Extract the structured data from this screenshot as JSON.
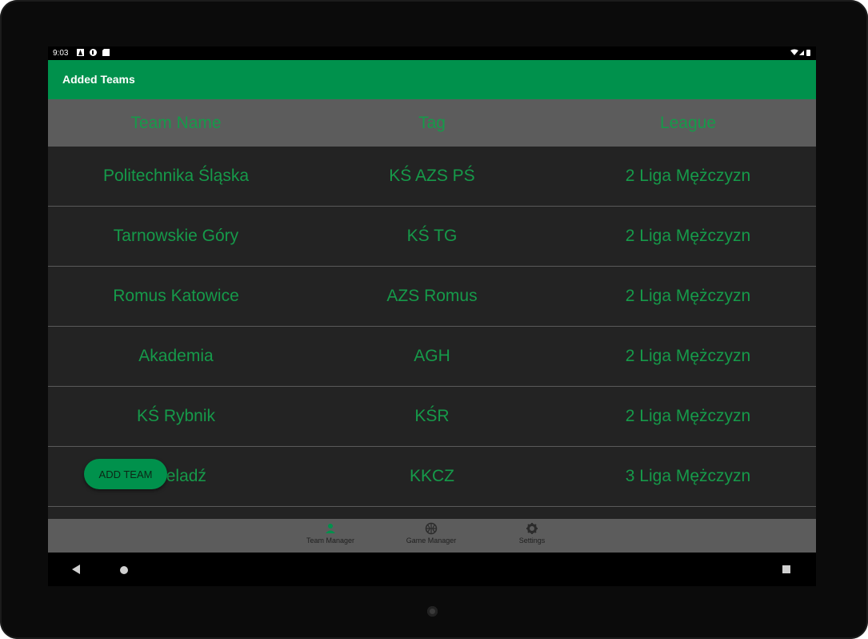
{
  "status_bar": {
    "time": "9:03"
  },
  "app_bar": {
    "title": "Added Teams"
  },
  "table": {
    "columns": [
      "Team Name",
      "Tag",
      "League"
    ],
    "rows": [
      [
        "Politechnika Śląska",
        "KŚ AZS PŚ",
        "2 Liga Mężczyzn"
      ],
      [
        "Tarnowskie Góry",
        "KŚ TG",
        "2 Liga Mężczyzn"
      ],
      [
        "Romus Katowice",
        "AZS Romus",
        "2 Liga Mężczyzn"
      ],
      [
        "Akademia",
        "AGH",
        "2 Liga Mężczyzn"
      ],
      [
        "KŚ Rybnik",
        "KŚR",
        "2 Liga Mężczyzn"
      ],
      [
        "Czeladź",
        "KKCZ",
        "3 Liga Mężczyzn"
      ]
    ]
  },
  "fab": {
    "label": "ADD TEAM"
  },
  "bottom_nav": {
    "items": [
      {
        "label": "Team Manager",
        "icon": "team-icon"
      },
      {
        "label": "Game Manager",
        "icon": "basketball-icon"
      },
      {
        "label": "Settings",
        "icon": "gear-icon"
      }
    ]
  },
  "colors": {
    "accent": "#00914c",
    "text_green": "#169a4a",
    "row_bg": "#232323",
    "header_bg": "#5c5c5c"
  }
}
